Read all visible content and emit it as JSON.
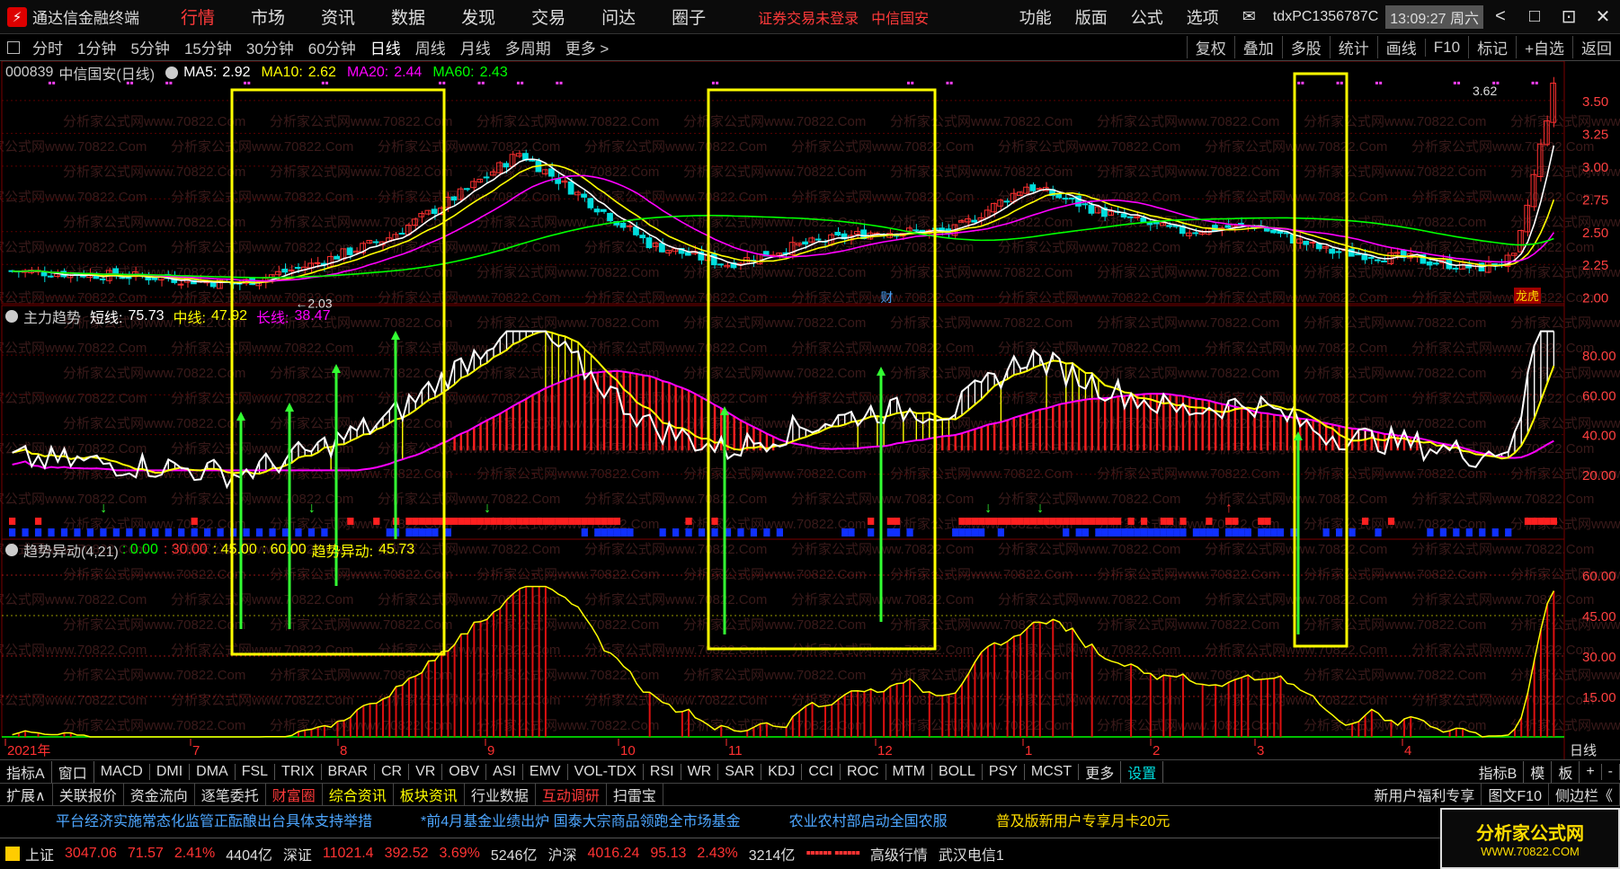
{
  "app": {
    "title": "通达信金融终端",
    "menus": [
      "行情",
      "市场",
      "资讯",
      "数据",
      "发现",
      "交易",
      "问达",
      "圈子"
    ],
    "active_menu": "行情",
    "login_status": "证券交易未登录",
    "broker": "中信国安",
    "right_menus": [
      "功能",
      "版面",
      "公式",
      "选项"
    ],
    "user_id": "tdxPC1356787C",
    "clock": "13:09:27 周六",
    "win_buttons": [
      "<",
      "□",
      "⊡",
      "✕"
    ]
  },
  "periods": {
    "tabs": [
      "分时",
      "1分钟",
      "5分钟",
      "15分钟",
      "30分钟",
      "60分钟",
      "日线",
      "周线",
      "月线",
      "多周期",
      "更多 >"
    ],
    "active": "日线",
    "tools": [
      "复权",
      "叠加",
      "多股",
      "统计",
      "画线",
      "F10",
      "标记",
      "+自选",
      "返回"
    ]
  },
  "main_panel": {
    "code": "000839",
    "name": "中信国安(日线)",
    "ma": [
      {
        "label": "MA5:",
        "value": "2.92",
        "color": "#ffffff"
      },
      {
        "label": "MA10:",
        "value": "2.62",
        "color": "#ffff00"
      },
      {
        "label": "MA20:",
        "value": "2.44",
        "color": "#ff00ff"
      },
      {
        "label": "MA60:",
        "value": "2.43",
        "color": "#00ff00"
      }
    ],
    "y_ticks": [
      "3.50",
      "3.25",
      "3.00",
      "2.75",
      "2.50",
      "2.25",
      "2.00"
    ],
    "low_label": "←2.03",
    "high_label": "3.62",
    "badge_cai": "财",
    "badge_lhb": "龙虎"
  },
  "indicator1": {
    "name": "主力趋势",
    "values": [
      {
        "label": "短线:",
        "value": "75.73",
        "color": "#ffffff"
      },
      {
        "label": "中线:",
        "value": "47.92",
        "color": "#ffff00"
      },
      {
        "label": "长线:",
        "value": "38.47",
        "color": "#ff00ff"
      }
    ],
    "y_ticks": [
      "80.00",
      "60.00",
      "40.00",
      "20.00"
    ]
  },
  "indicator2": {
    "name": "趋势异动(4,21)",
    "values": [
      {
        "label": "",
        "value": ": 0.00",
        "color": "#00ff00"
      },
      {
        "label": "",
        "value": ": 30.00",
        "color": "#ff3030"
      },
      {
        "label": "",
        "value": ": 45.00",
        "color": "#ffff00"
      },
      {
        "label": "",
        "value": ": 60.00",
        "color": "#ffff00"
      },
      {
        "label": "趋势异动:",
        "value": "45.73",
        "color": "#ffff00"
      }
    ],
    "y_ticks": [
      "60.00",
      "45.00",
      "30.00",
      "15.00"
    ]
  },
  "x_axis": {
    "labels": [
      "2021年",
      "7",
      "8",
      "9",
      "10",
      "11",
      "12",
      "1",
      "2",
      "3",
      "4"
    ],
    "period_label": "日线"
  },
  "indicator_tabs": {
    "items": [
      "指标A",
      "窗口",
      "MACD",
      "DMI",
      "DMA",
      "FSL",
      "TRIX",
      "BRAR",
      "CR",
      "VR",
      "OBV",
      "ASI",
      "EMV",
      "VOL-TDX",
      "RSI",
      "WR",
      "SAR",
      "KDJ",
      "CCI",
      "ROC",
      "MTM",
      "BOLL",
      "PSY",
      "MCST",
      "更多",
      "设置"
    ],
    "active": "设置",
    "right": [
      "指标B",
      "模",
      "板",
      "+",
      "-"
    ]
  },
  "sub_tabs": {
    "items": [
      {
        "label": "扩展∧",
        "color": ""
      },
      {
        "label": "关联报价",
        "color": ""
      },
      {
        "label": "资金流向",
        "color": ""
      },
      {
        "label": "逐笔委托",
        "color": ""
      },
      {
        "label": "财富圈",
        "color": "red"
      },
      {
        "label": "综合资讯",
        "color": "yel"
      },
      {
        "label": "板块资讯",
        "color": "yel"
      },
      {
        "label": "行业数据",
        "color": ""
      },
      {
        "label": "互动调研",
        "color": "red"
      },
      {
        "label": "扫雷宝",
        "color": ""
      }
    ],
    "right": [
      "新用户福利专享",
      "图文F10",
      "侧边栏《"
    ]
  },
  "news": {
    "items": [
      "平台经济实施常态化监管正酝酿出台具体支持举措",
      "*前4月基金业绩出炉 国泰大宗商品领跑全市场基金",
      "农业农村部启动全国农服",
      "普及版新用户专享月卡20元"
    ]
  },
  "status": {
    "sh": {
      "name": "上证",
      "index": "3047.06",
      "chg": "71.57",
      "pct": "2.41%",
      "vol": "4404亿"
    },
    "sz": {
      "name": "深证",
      "index": "11021.4",
      "chg": "392.52",
      "pct": "3.69%",
      "vol": "5246亿"
    },
    "hs": {
      "name": "沪深",
      "index": "4016.24",
      "chg": "95.13",
      "pct": "2.43%",
      "vol": "3214亿"
    },
    "level": "高级行情",
    "server": "武汉电信1"
  },
  "watermark": {
    "title": "分析家公式网",
    "url": "WWW.70822.COM",
    "bg_text": "分析家公式网www.70822.Com"
  },
  "colors": {
    "up": "#ff3030",
    "down": "#00dddd",
    "ma5": "#ffffff",
    "ma10": "#ffff00",
    "ma20": "#ff00ff",
    "ma60": "#00ff00",
    "box": "#ffff00",
    "arrow": "#33ff33"
  }
}
